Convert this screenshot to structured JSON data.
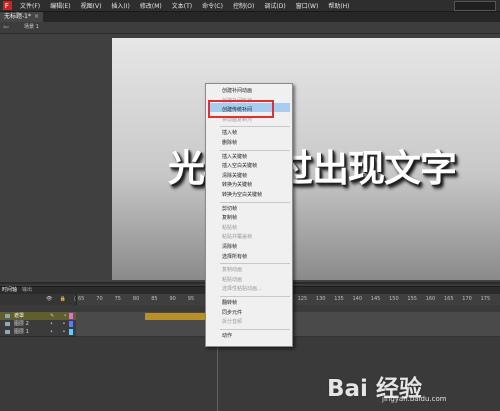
{
  "menubar": {
    "items": [
      "文件(F)",
      "编辑(E)",
      "视图(V)",
      "插入(I)",
      "修改(M)",
      "文本(T)",
      "命令(C)",
      "控制(O)",
      "调试(D)",
      "窗口(W)",
      "帮助(H)"
    ]
  },
  "document_tab": {
    "title": "无标题-1*",
    "close": "×"
  },
  "breadcrumb": {
    "scene": "场景 1"
  },
  "stage": {
    "text": "光标滑过出现文字"
  },
  "context_menu": {
    "items": [
      {
        "label": "创建补间动画",
        "enabled": true
      },
      {
        "label": "创建补间形状",
        "enabled": false
      },
      {
        "label": "创建传统补间",
        "enabled": true,
        "highlighted": true
      },
      {
        "label": "将动画复制为",
        "enabled": false
      },
      {
        "label": "插入帧",
        "enabled": true,
        "sep_before": true
      },
      {
        "label": "删除帧",
        "enabled": true
      },
      {
        "label": "插入关键帧",
        "enabled": true,
        "sep_before": true
      },
      {
        "label": "插入空白关键帧",
        "enabled": true
      },
      {
        "label": "清除关键帧",
        "enabled": true
      },
      {
        "label": "转换为关键帧",
        "enabled": true
      },
      {
        "label": "转换为空白关键帧",
        "enabled": true
      },
      {
        "label": "剪切帧",
        "enabled": true,
        "sep_before": true
      },
      {
        "label": "复制帧",
        "enabled": true
      },
      {
        "label": "粘贴帧",
        "enabled": false
      },
      {
        "label": "粘贴并覆盖帧",
        "enabled": false
      },
      {
        "label": "清除帧",
        "enabled": true
      },
      {
        "label": "选择所有帧",
        "enabled": true
      },
      {
        "label": "复制动画",
        "enabled": false,
        "sep_before": true
      },
      {
        "label": "粘贴动画",
        "enabled": false
      },
      {
        "label": "选择性粘贴动画...",
        "enabled": false
      },
      {
        "label": "翻转帧",
        "enabled": true,
        "sep_before": true
      },
      {
        "label": "同步元件",
        "enabled": true
      },
      {
        "label": "拆分音频",
        "enabled": false
      },
      {
        "label": "动作",
        "enabled": true,
        "sep_before": true
      }
    ]
  },
  "timeline": {
    "tabs": [
      "时间轴",
      "输出"
    ],
    "ruler_ticks": [
      "65",
      "70",
      "75",
      "80",
      "85",
      "90",
      "95",
      "100",
      "105",
      "110",
      "115",
      "120",
      "125",
      "130",
      "135",
      "140",
      "145",
      "150",
      "155",
      "160",
      "165",
      "170",
      "175"
    ],
    "layers": [
      {
        "name": "遮罩",
        "selected": true,
        "color": "#e06cd6"
      },
      {
        "name": "图层 2",
        "selected": false,
        "color": "#5b7bff"
      },
      {
        "name": "图层 1",
        "selected": false,
        "color": "#5bd0ff"
      }
    ],
    "header_icons": "👁 🔒 ▢"
  },
  "watermark": {
    "brand": "Bai 经验",
    "url": "jingyan.baidu.com"
  }
}
